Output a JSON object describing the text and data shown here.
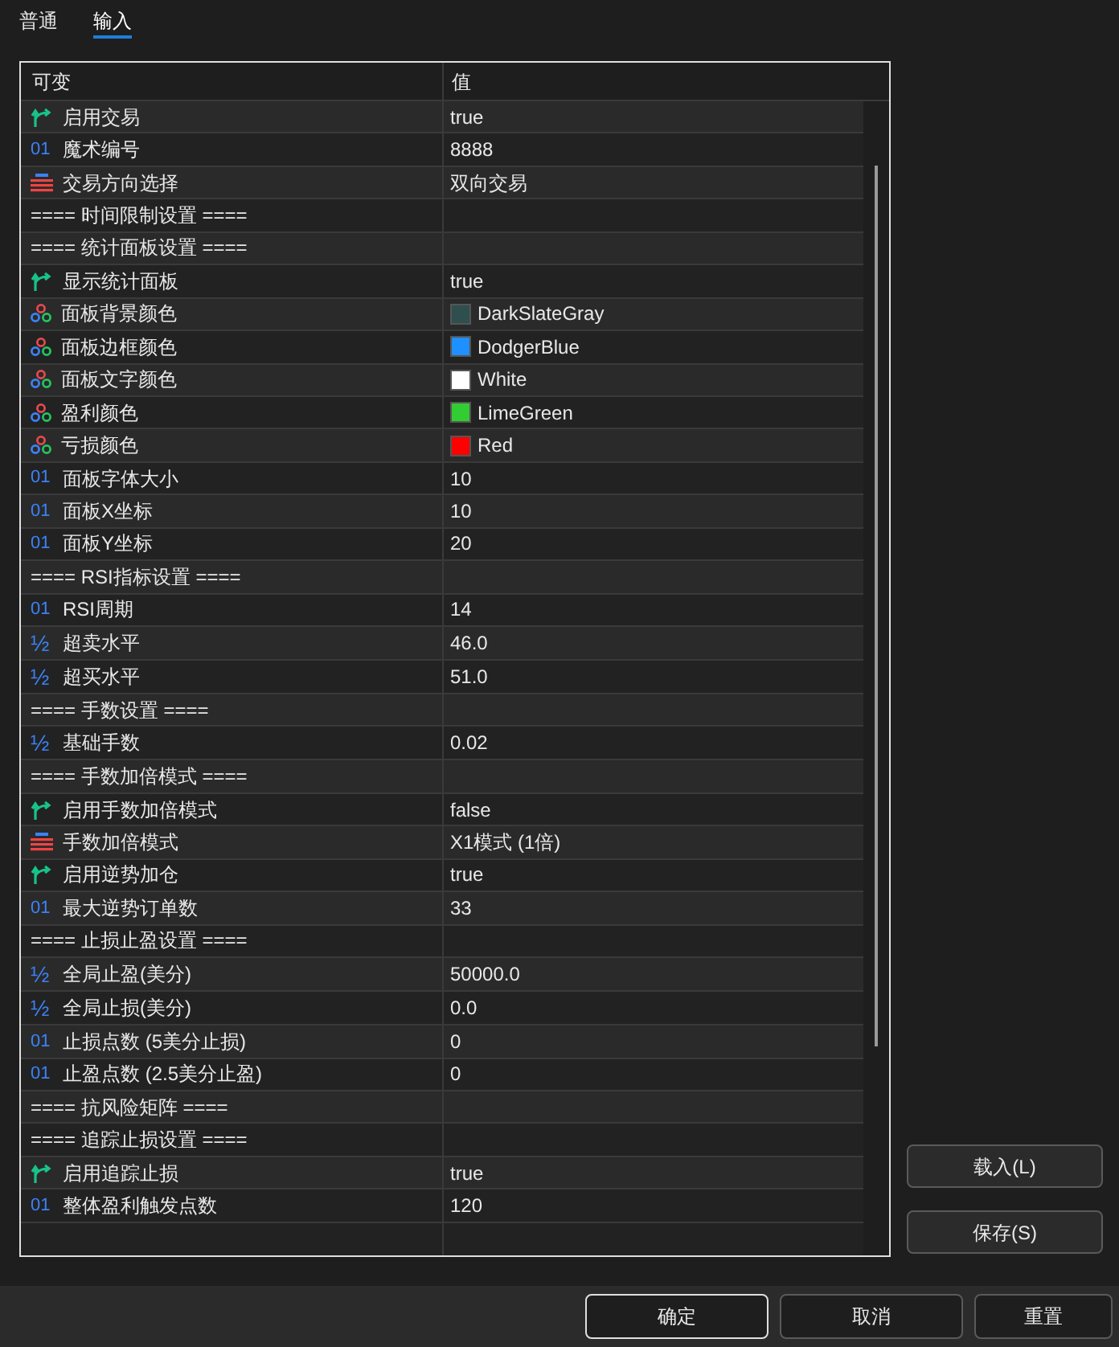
{
  "tabs": [
    {
      "label": "普通",
      "selected": false
    },
    {
      "label": "输入",
      "selected": true
    }
  ],
  "table": {
    "columns": [
      "可变",
      "值"
    ],
    "rows": [
      {
        "kind": "bool",
        "name": "启用交易",
        "value": "true"
      },
      {
        "kind": "int",
        "icon": "01",
        "name": "魔术编号",
        "value": "8888"
      },
      {
        "kind": "enum",
        "name": "交易方向选择",
        "value": "双向交易"
      },
      {
        "kind": "section",
        "name": "==== 时间限制设置 ===="
      },
      {
        "kind": "section",
        "name": "==== 统计面板设置 ===="
      },
      {
        "kind": "bool",
        "name": "显示统计面板",
        "value": "true"
      },
      {
        "kind": "color",
        "name": "面板背景颜色",
        "value": "DarkSlateGray",
        "color": "#2f4f4f"
      },
      {
        "kind": "color",
        "name": "面板边框颜色",
        "value": "DodgerBlue",
        "color": "#1e90ff"
      },
      {
        "kind": "color",
        "name": "面板文字颜色",
        "value": "White",
        "color": "#ffffff"
      },
      {
        "kind": "color",
        "name": "盈利颜色",
        "value": "LimeGreen",
        "color": "#32cd32"
      },
      {
        "kind": "color",
        "name": "亏损颜色",
        "value": "Red",
        "color": "#ff0000"
      },
      {
        "kind": "int",
        "icon": "01",
        "name": "面板字体大小",
        "value": "10"
      },
      {
        "kind": "int",
        "icon": "01",
        "name": "面板X坐标",
        "value": "10"
      },
      {
        "kind": "int",
        "icon": "01",
        "name": "面板Y坐标",
        "value": "20"
      },
      {
        "kind": "section",
        "name": "==== RSI指标设置 ===="
      },
      {
        "kind": "int",
        "icon": "01",
        "name": "RSI周期",
        "value": "14"
      },
      {
        "kind": "double",
        "icon": "½",
        "name": "超卖水平",
        "value": "46.0"
      },
      {
        "kind": "double",
        "icon": "½",
        "name": "超买水平",
        "value": "51.0"
      },
      {
        "kind": "section",
        "name": "==== 手数设置 ===="
      },
      {
        "kind": "double",
        "icon": "½",
        "name": "基础手数",
        "value": "0.02"
      },
      {
        "kind": "section",
        "name": "==== 手数加倍模式 ===="
      },
      {
        "kind": "bool",
        "name": "启用手数加倍模式",
        "value": "false"
      },
      {
        "kind": "enum",
        "name": "手数加倍模式",
        "value": "X1模式 (1倍)"
      },
      {
        "kind": "bool",
        "name": "启用逆势加仓",
        "value": "true"
      },
      {
        "kind": "int",
        "icon": "01",
        "name": "最大逆势订单数",
        "value": "33"
      },
      {
        "kind": "section",
        "name": "==== 止损止盈设置 ===="
      },
      {
        "kind": "double",
        "icon": "½",
        "name": "全局止盈(美分)",
        "value": "50000.0"
      },
      {
        "kind": "double",
        "icon": "½",
        "name": "全局止损(美分)",
        "value": "0.0"
      },
      {
        "kind": "int",
        "icon": "01",
        "name": "止损点数 (5美分止损)",
        "value": "0"
      },
      {
        "kind": "int",
        "icon": "01",
        "name": "止盈点数 (2.5美分止盈)",
        "value": "0"
      },
      {
        "kind": "section",
        "name": "==== 抗风险矩阵 ===="
      },
      {
        "kind": "section",
        "name": "==== 追踪止损设置 ===="
      },
      {
        "kind": "bool",
        "name": "启用追踪止损",
        "value": "true"
      },
      {
        "kind": "int",
        "icon": "01",
        "name": "整体盈利触发点数",
        "value": "120"
      }
    ]
  },
  "side_buttons": [
    "载入(L)",
    "保存(S)"
  ],
  "buttons": [
    {
      "label": "确定",
      "default": true
    },
    {
      "label": "取消",
      "default": false
    },
    {
      "label": "重置",
      "default": false
    }
  ]
}
